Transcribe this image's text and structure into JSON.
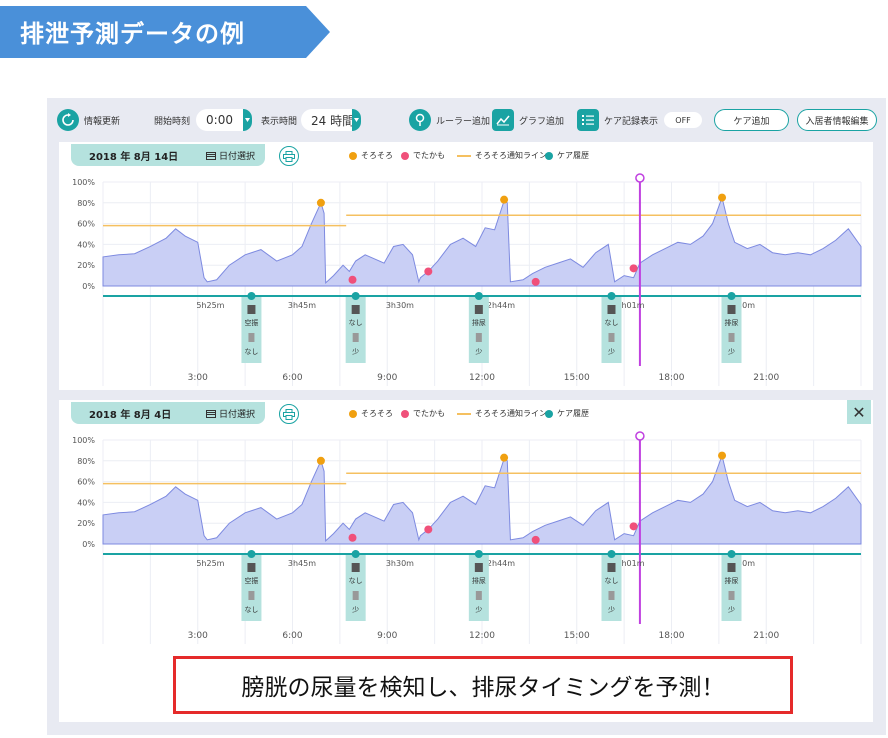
{
  "banner": {
    "title": "排泄予測データの例",
    "color": "#4a90d9"
  },
  "toolbar": {
    "refresh_label": "情報更新",
    "start_time_label": "開始時刻",
    "start_time_value": "0:00",
    "display_time_label": "表示時間",
    "display_time_value": "24 時間",
    "ruler_add_label": "ルーラー追加",
    "graph_add_label": "グラフ追加",
    "care_record_label": "ケア記録表示",
    "care_record_toggle": "OFF",
    "care_add_label": "ケア追加",
    "resident_edit_label": "入居者情報編集"
  },
  "legend": {
    "sorosoro": "そろそろ",
    "detakamo": "でたかも",
    "notify_line": "そろそろ通知ライン",
    "care_history": "ケア履歴"
  },
  "colors": {
    "accent": "#1aa3a3",
    "area_fill": "#c9cff5",
    "area_line": "#7d8ae0",
    "sorosoro": "#f0a010",
    "detakamo": "#f0507a",
    "notify_line": "#f5c060",
    "cursor": "#c040e0",
    "care_box": "#b5e2de"
  },
  "panels": [
    {
      "date_label": "2018 年  8月 14日",
      "date_select_label": "日付選択",
      "notify_levels": [
        {
          "from": 0,
          "to": 7.7,
          "level": 58
        },
        {
          "from": 7.7,
          "to": 24,
          "level": 68
        }
      ],
      "cursor_hour": 17.0,
      "sorosoro_points": [
        {
          "x": 6.9,
          "y": 80
        },
        {
          "x": 12.7,
          "y": 83
        },
        {
          "x": 19.6,
          "y": 85
        }
      ],
      "detakamo_points": [
        {
          "x": 7.9,
          "y": 6
        },
        {
          "x": 10.3,
          "y": 14
        },
        {
          "x": 13.7,
          "y": 4
        },
        {
          "x": 16.8,
          "y": 17
        }
      ],
      "intervals": [
        "5h25m",
        "3h45m",
        "3h30m",
        "2h44m",
        "3h01m",
        "3h30m"
      ],
      "care_events": [
        {
          "x": 4.7,
          "top": "空振",
          "bottom": "なし"
        },
        {
          "x": 8.0,
          "top": "なし",
          "bottom": "少"
        },
        {
          "x": 11.9,
          "top": "排尿",
          "bottom": "少"
        },
        {
          "x": 16.1,
          "top": "なし",
          "bottom": "少"
        },
        {
          "x": 19.9,
          "top": "排尿",
          "bottom": "少"
        }
      ]
    },
    {
      "date_label": "2018 年  8月 4日",
      "date_select_label": "日付選択",
      "close_label": "✕",
      "notify_levels": [
        {
          "from": 0,
          "to": 7.7,
          "level": 58
        },
        {
          "from": 7.7,
          "to": 24,
          "level": 68
        }
      ],
      "cursor_hour": 17.0,
      "sorosoro_points": [
        {
          "x": 6.9,
          "y": 80
        },
        {
          "x": 12.7,
          "y": 83
        },
        {
          "x": 19.6,
          "y": 85
        }
      ],
      "detakamo_points": [
        {
          "x": 7.9,
          "y": 6
        },
        {
          "x": 10.3,
          "y": 14
        },
        {
          "x": 13.7,
          "y": 4
        },
        {
          "x": 16.8,
          "y": 17
        }
      ],
      "intervals": [
        "5h25m",
        "3h45m",
        "3h30m",
        "2h44m",
        "3h01m",
        "3h30m"
      ],
      "care_events": [
        {
          "x": 4.7,
          "top": "空振",
          "bottom": "なし"
        },
        {
          "x": 8.0,
          "top": "なし",
          "bottom": "少"
        },
        {
          "x": 11.9,
          "top": "排尿",
          "bottom": "少"
        },
        {
          "x": 16.1,
          "top": "なし",
          "bottom": "少"
        },
        {
          "x": 19.9,
          "top": "排尿",
          "bottom": "少"
        }
      ]
    }
  ],
  "chart_data": [
    {
      "type": "area",
      "x_ticks": [
        "3:00",
        "6:00",
        "9:00",
        "12:00",
        "15:00",
        "18:00",
        "21:00"
      ],
      "y_ticks": [
        "100%",
        "80%",
        "60%",
        "40%",
        "20%",
        "0%"
      ],
      "ylim": [
        0,
        100
      ],
      "xlim": [
        0,
        24
      ],
      "series": [
        {
          "x": [
            0,
            0.5,
            1,
            1.5,
            2,
            2.3,
            2.6,
            3,
            3.2,
            3.3,
            3.6,
            4,
            4.5,
            5,
            5.5,
            6,
            6.3,
            6.6,
            6.9,
            7.0,
            7.05,
            7.3,
            7.6,
            7.8,
            8.0,
            8.3,
            8.6,
            8.9,
            9.2,
            9.5,
            9.8,
            10.0,
            10.05,
            10.3,
            10.6,
            11.0,
            11.4,
            11.8,
            12.1,
            12.4,
            12.7,
            12.8,
            12.9,
            13.3,
            13.6,
            14.0,
            14.4,
            14.8,
            15.2,
            15.6,
            16.0,
            16.2,
            16.5,
            16.8,
            17.0,
            17.4,
            17.8,
            18.2,
            18.6,
            19.0,
            19.3,
            19.6,
            19.8,
            20.0,
            20.4,
            20.8,
            21.2,
            21.6,
            22.0,
            22.4,
            22.8,
            23.2,
            23.6,
            24
          ],
          "values": [
            28,
            30,
            31,
            38,
            46,
            55,
            48,
            42,
            8,
            4,
            6,
            20,
            30,
            35,
            24,
            30,
            38,
            60,
            80,
            70,
            3,
            10,
            20,
            14,
            24,
            30,
            26,
            22,
            38,
            40,
            30,
            4,
            8,
            14,
            24,
            40,
            46,
            38,
            56,
            54,
            82,
            80,
            4,
            6,
            12,
            18,
            22,
            26,
            18,
            32,
            40,
            4,
            10,
            8,
            22,
            30,
            36,
            42,
            40,
            48,
            60,
            85,
            60,
            42,
            36,
            40,
            32,
            30,
            32,
            30,
            36,
            44,
            55,
            38
          ]
        }
      ]
    }
  ],
  "caption": "膀胱の尿量を検知し、排尿タイミングを予測！"
}
